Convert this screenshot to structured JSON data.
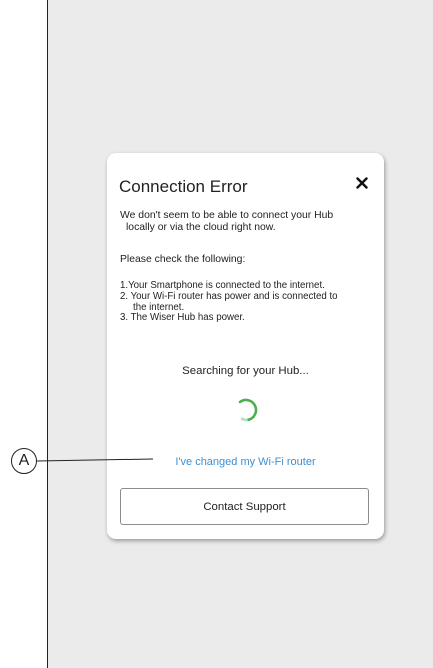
{
  "dialog": {
    "title": "Connection Error",
    "close_icon": "close-icon",
    "intro_line1": "We don't seem to be able to connect your Hub",
    "intro_line2": "locally or via the cloud right now.",
    "check_heading": "Please check the following:",
    "checklist": {
      "item1": "1.Your Smartphone is connected to the  internet.",
      "item2": "2. Your Wi-Fi router has power and is connected to",
      "item2_cont": "the  internet.",
      "item3": "3. The Wiser Hub has power."
    },
    "searching_text": "Searching for your Hub...",
    "spinner_icon": "loading-spinner-icon",
    "spinner_color": "#4caf50",
    "wifi_link": "I've changed my Wi-Fi router",
    "link_color": "#3d8fd1",
    "contact_button": "Contact Support"
  },
  "callout": {
    "label": "A"
  }
}
